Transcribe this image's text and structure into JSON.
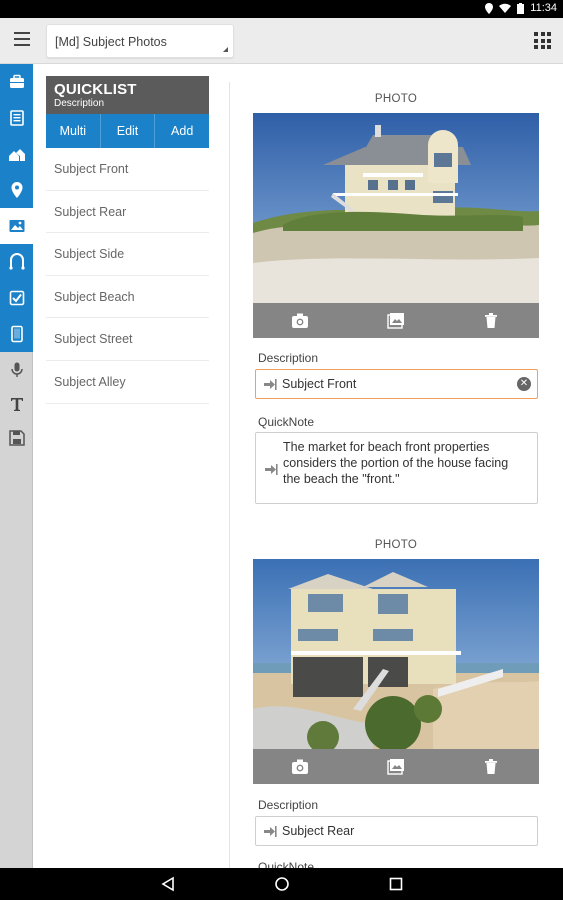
{
  "status_bar": {
    "time": "11:34"
  },
  "top_bar": {
    "page_selector_value": "[Md] Subject Photos"
  },
  "side_rail": {
    "items": [
      {
        "icon": "briefcase-icon"
      },
      {
        "icon": "form-icon"
      },
      {
        "icon": "houses-icon"
      },
      {
        "icon": "map-pin-icon"
      },
      {
        "icon": "photo-icon"
      },
      {
        "icon": "sketch-icon"
      },
      {
        "icon": "checklist-icon"
      },
      {
        "icon": "tablet-icon"
      },
      {
        "icon": "microphone-icon"
      },
      {
        "icon": "text-icon"
      },
      {
        "icon": "save-icon"
      }
    ]
  },
  "quicklist": {
    "title": "QUICKLIST",
    "subtitle": "Description",
    "actions": [
      "Multi",
      "Edit",
      "Add"
    ],
    "items": [
      "Subject Front",
      "Subject Rear",
      "Subject Side",
      "Subject Beach",
      "Subject Street",
      "Subject Alley"
    ]
  },
  "photos": [
    {
      "section_label": "PHOTO",
      "description_label": "Description",
      "description_value": "Subject Front",
      "quicknote_label": "QuickNote",
      "quicknote_value": "The market for beach front properties considers the portion of the house facing the beach the \"front.\""
    },
    {
      "section_label": "PHOTO",
      "description_label": "Description",
      "description_value": "Subject Rear",
      "quicknote_label": "QuickNote"
    }
  ],
  "colors": {
    "accent_blue": "#1b82c9",
    "header_gray": "#5b5b5b",
    "focus_orange": "#f0a05a"
  }
}
